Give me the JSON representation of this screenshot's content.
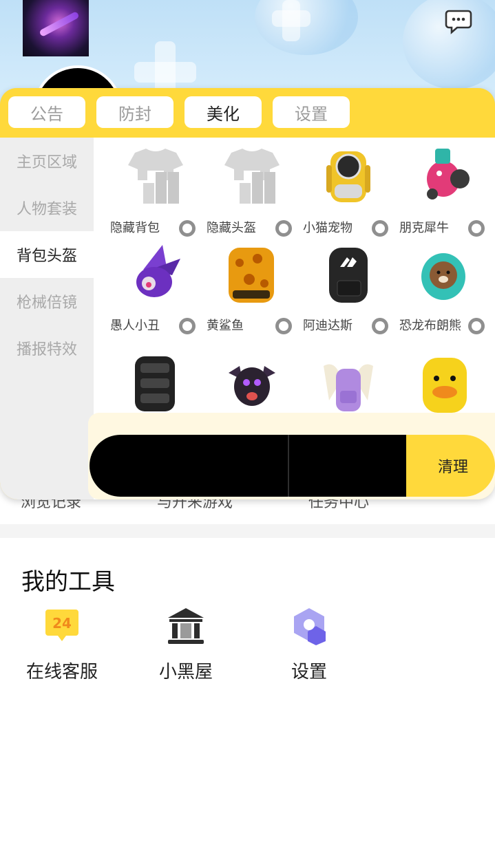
{
  "tabs": [
    {
      "label": "公告",
      "active": false
    },
    {
      "label": "防封",
      "active": false
    },
    {
      "label": "美化",
      "active": true
    },
    {
      "label": "设置",
      "active": false
    }
  ],
  "sidebar": [
    {
      "label": "主页区域",
      "active": false
    },
    {
      "label": "人物套装",
      "active": false
    },
    {
      "label": "背包头盔",
      "active": true
    },
    {
      "label": "枪械倍镜",
      "active": false
    },
    {
      "label": "播报特效",
      "active": false
    }
  ],
  "items": [
    {
      "label": "隐藏背包",
      "icon": "shirt-placeholder-icon"
    },
    {
      "label": "隐藏头盔",
      "icon": "shirt-placeholder-icon"
    },
    {
      "label": "小猫宠物",
      "icon": "cat-backpack-icon"
    },
    {
      "label": "朋克犀牛",
      "icon": "punk-rhino-backpack-icon"
    },
    {
      "label": "愚人小丑",
      "icon": "jester-backpack-icon"
    },
    {
      "label": "黄鲨鱼",
      "icon": "yellow-shark-backpack-icon"
    },
    {
      "label": "阿迪达斯",
      "icon": "adidas-backpack-icon"
    },
    {
      "label": "恐龙布朗熊",
      "icon": "dino-brown-bear-backpack-icon"
    },
    {
      "label": "",
      "icon": "black-armored-backpack-icon"
    },
    {
      "label": "",
      "icon": "black-dragon-backpack-icon"
    },
    {
      "label": "",
      "icon": "butterfly-backpack-icon"
    },
    {
      "label": "",
      "icon": "yellow-duck-backpack-icon"
    }
  ],
  "clean_button": "清理",
  "peek_text": "浏览记录　　　　　与开来游戏　　　　　任务中心",
  "tools": {
    "title": "我的工具",
    "items": [
      {
        "label": "在线客服",
        "icon": "customer-service-24-icon",
        "badge": "24"
      },
      {
        "label": "小黑屋",
        "icon": "black-house-icon"
      },
      {
        "label": "设置",
        "icon": "settings-hexagon-icon"
      }
    ]
  },
  "colors": {
    "accent": "#ffd93b",
    "sidebar": "#eeeeee",
    "bar": "#000000"
  }
}
